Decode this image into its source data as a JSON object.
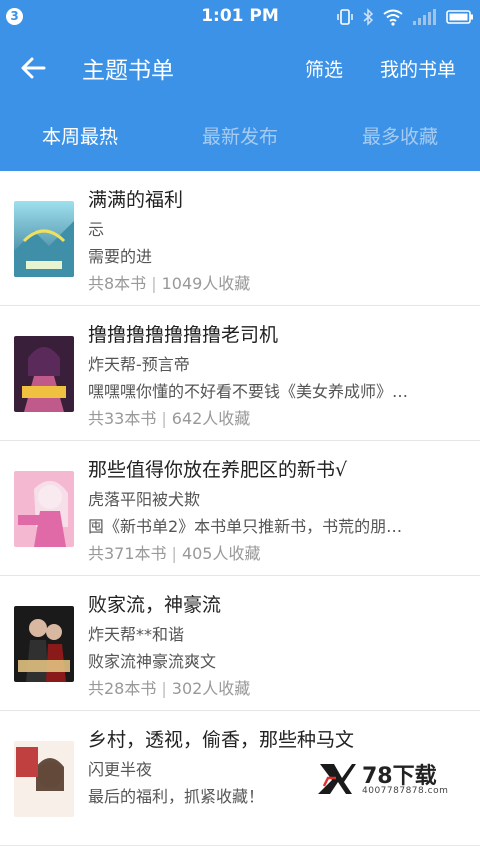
{
  "status_bar": {
    "notification_count": "3",
    "time": "1:01 PM"
  },
  "header": {
    "title": "主题书单",
    "filter_label": "筛选",
    "my_list_label": "我的书单"
  },
  "tabs": [
    {
      "label": "本周最热",
      "active": true
    },
    {
      "label": "最新发布",
      "active": false
    },
    {
      "label": "最多收藏",
      "active": false
    }
  ],
  "booklists": [
    {
      "title": "满满的福利",
      "author": "忈",
      "desc": "需要的进",
      "book_count": "共8本书",
      "favorites": "1049人收藏",
      "cover_colors": [
        "#2a6f8a",
        "#7fd0e0",
        "#e8f4d0"
      ]
    },
    {
      "title": "撸撸撸撸撸撸撸老司机",
      "author": "炸天帮-预言帝",
      "desc": "嘿嘿嘿你懂的不好看不要钱《美女养成师》…",
      "book_count": "共33本书",
      "favorites": "642人收藏",
      "cover_colors": [
        "#3a1f3a",
        "#c05a8a",
        "#f0c040"
      ]
    },
    {
      "title": "那些值得你放在养肥区的新书√",
      "author": "虎落平阳被犬欺",
      "desc": "囤《新书单2》本书单只推新书，书荒的朋…",
      "book_count": "共371本书",
      "favorites": "405人收藏",
      "cover_colors": [
        "#f4b8d0",
        "#e06aa8",
        "#ffffff"
      ]
    },
    {
      "title": "败家流，神豪流",
      "author": "炸天帮**和谐",
      "desc": "败家流神豪流爽文",
      "book_count": "共28本书",
      "favorites": "302人收藏",
      "cover_colors": [
        "#1a1a1a",
        "#8a1a1a",
        "#e0c080"
      ]
    },
    {
      "title": "乡村，透视，偷香，那些种马文",
      "author": "闪更半夜",
      "desc": "最后的福利，抓紧收藏！",
      "book_count": "",
      "favorites": "",
      "cover_colors": [
        "#f0e0d0",
        "#c04040",
        "#f8f0e8"
      ]
    }
  ],
  "watermark": {
    "text": "78下载",
    "phone": "4007787878.com"
  },
  "colors": {
    "brand_blue": "#3c92e6",
    "inactive_tab": "#a6cbf2"
  }
}
